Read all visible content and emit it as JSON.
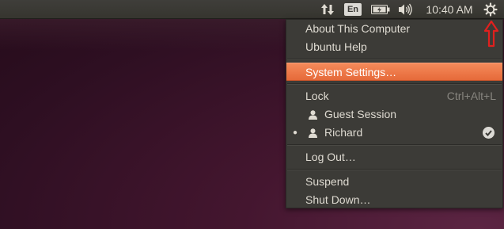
{
  "panel": {
    "keyboard_layout": "En",
    "clock": "10:40 AM",
    "icons": [
      "network-updown-icon",
      "battery-icon",
      "volume-icon",
      "session-gear-icon"
    ]
  },
  "menu": {
    "about": "About This Computer",
    "help": "Ubuntu Help",
    "settings": "System Settings…",
    "lock": "Lock",
    "lock_accel": "Ctrl+Alt+L",
    "guest": "Guest Session",
    "user": "Richard",
    "logout": "Log Out…",
    "suspend": "Suspend",
    "shutdown": "Shut Down…"
  },
  "colors": {
    "highlight": "#e66a3a",
    "menu_bg": "#3c3b37",
    "annotation_arrow": "#e0201e"
  }
}
